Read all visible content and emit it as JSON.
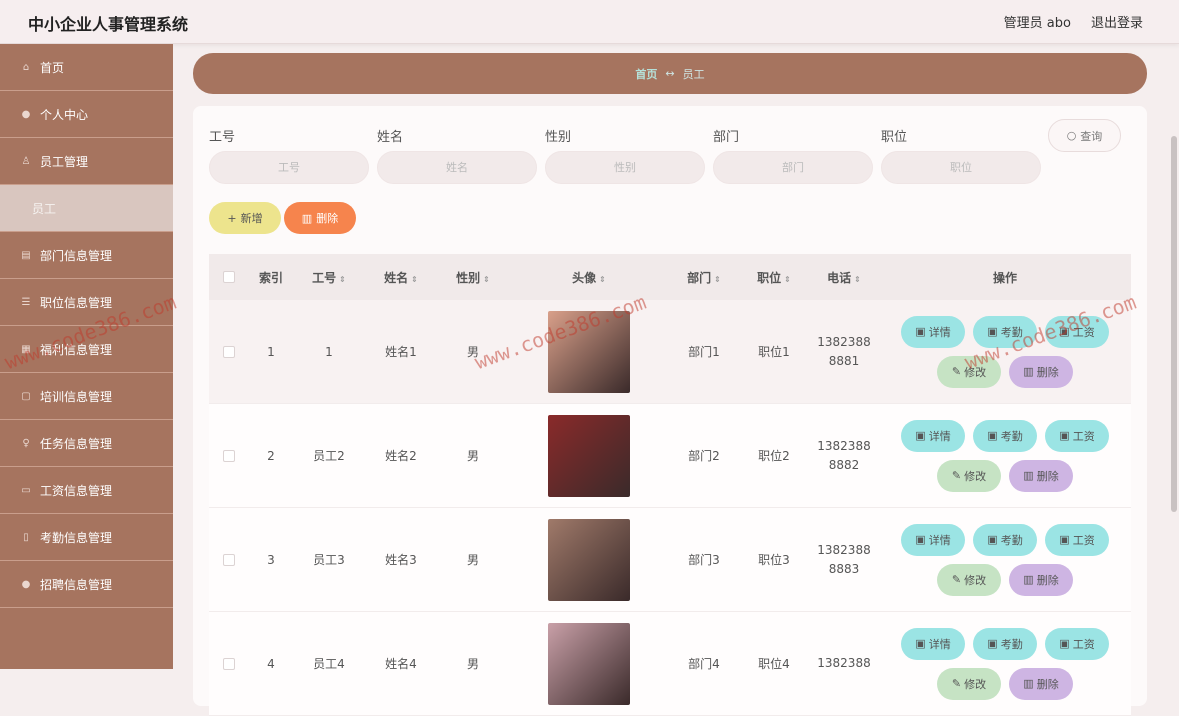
{
  "header": {
    "title": "中小企业人事管理系统",
    "user": "管理员 abo",
    "logout": "退出登录"
  },
  "sidebar": {
    "items": [
      {
        "label": "首页",
        "icon": "home-icon"
      },
      {
        "label": "个人中心",
        "icon": "user-icon"
      },
      {
        "label": "员工管理",
        "icon": "staff-icon"
      },
      {
        "label": "员工",
        "icon": "",
        "sub": true
      },
      {
        "label": "部门信息管理",
        "icon": "department-icon"
      },
      {
        "label": "职位信息管理",
        "icon": "position-icon"
      },
      {
        "label": "福利信息管理",
        "icon": "welfare-icon"
      },
      {
        "label": "培训信息管理",
        "icon": "training-icon"
      },
      {
        "label": "任务信息管理",
        "icon": "task-icon"
      },
      {
        "label": "工资信息管理",
        "icon": "salary-icon"
      },
      {
        "label": "考勤信息管理",
        "icon": "attendance-icon"
      },
      {
        "label": "招聘信息管理",
        "icon": "recruit-icon"
      }
    ]
  },
  "breadcrumb": {
    "home": "首页",
    "sep": "↔",
    "current": "员工"
  },
  "filters": [
    {
      "label": "工号",
      "placeholder": "工号"
    },
    {
      "label": "姓名",
      "placeholder": "姓名"
    },
    {
      "label": "性别",
      "placeholder": "性别"
    },
    {
      "label": "部门",
      "placeholder": "部门"
    },
    {
      "label": "职位",
      "placeholder": "职位"
    }
  ],
  "buttons": {
    "query": "查询",
    "add": "新增",
    "delete": "删除"
  },
  "table": {
    "headers": [
      "索引",
      "工号",
      "姓名",
      "性别",
      "头像",
      "部门",
      "职位",
      "电话",
      "操作"
    ],
    "rows": [
      {
        "index": "1",
        "id": "1",
        "name": "姓名1",
        "gender": "男",
        "dept": "部门1",
        "pos": "职位1",
        "phone1": "1382388",
        "phone2": "8881",
        "avatar_color": "#d9a08a"
      },
      {
        "index": "2",
        "id": "员工2",
        "name": "姓名2",
        "gender": "男",
        "dept": "部门2",
        "pos": "职位2",
        "phone1": "1382388",
        "phone2": "8882",
        "avatar_color": "#8a2a2a"
      },
      {
        "index": "3",
        "id": "员工3",
        "name": "姓名3",
        "gender": "男",
        "dept": "部门3",
        "pos": "职位3",
        "phone1": "1382388",
        "phone2": "8883",
        "avatar_color": "#a07a6a"
      },
      {
        "index": "4",
        "id": "员工4",
        "name": "姓名4",
        "gender": "男",
        "dept": "部门4",
        "pos": "职位4",
        "phone1": "1382388",
        "phone2": "",
        "avatar_color": "#c9a0a8"
      }
    ],
    "ops": {
      "detail": "详情",
      "attendance": "考勤",
      "salary": "工资",
      "edit": "修改",
      "remove": "删除"
    }
  },
  "watermark": "www.code386.com"
}
